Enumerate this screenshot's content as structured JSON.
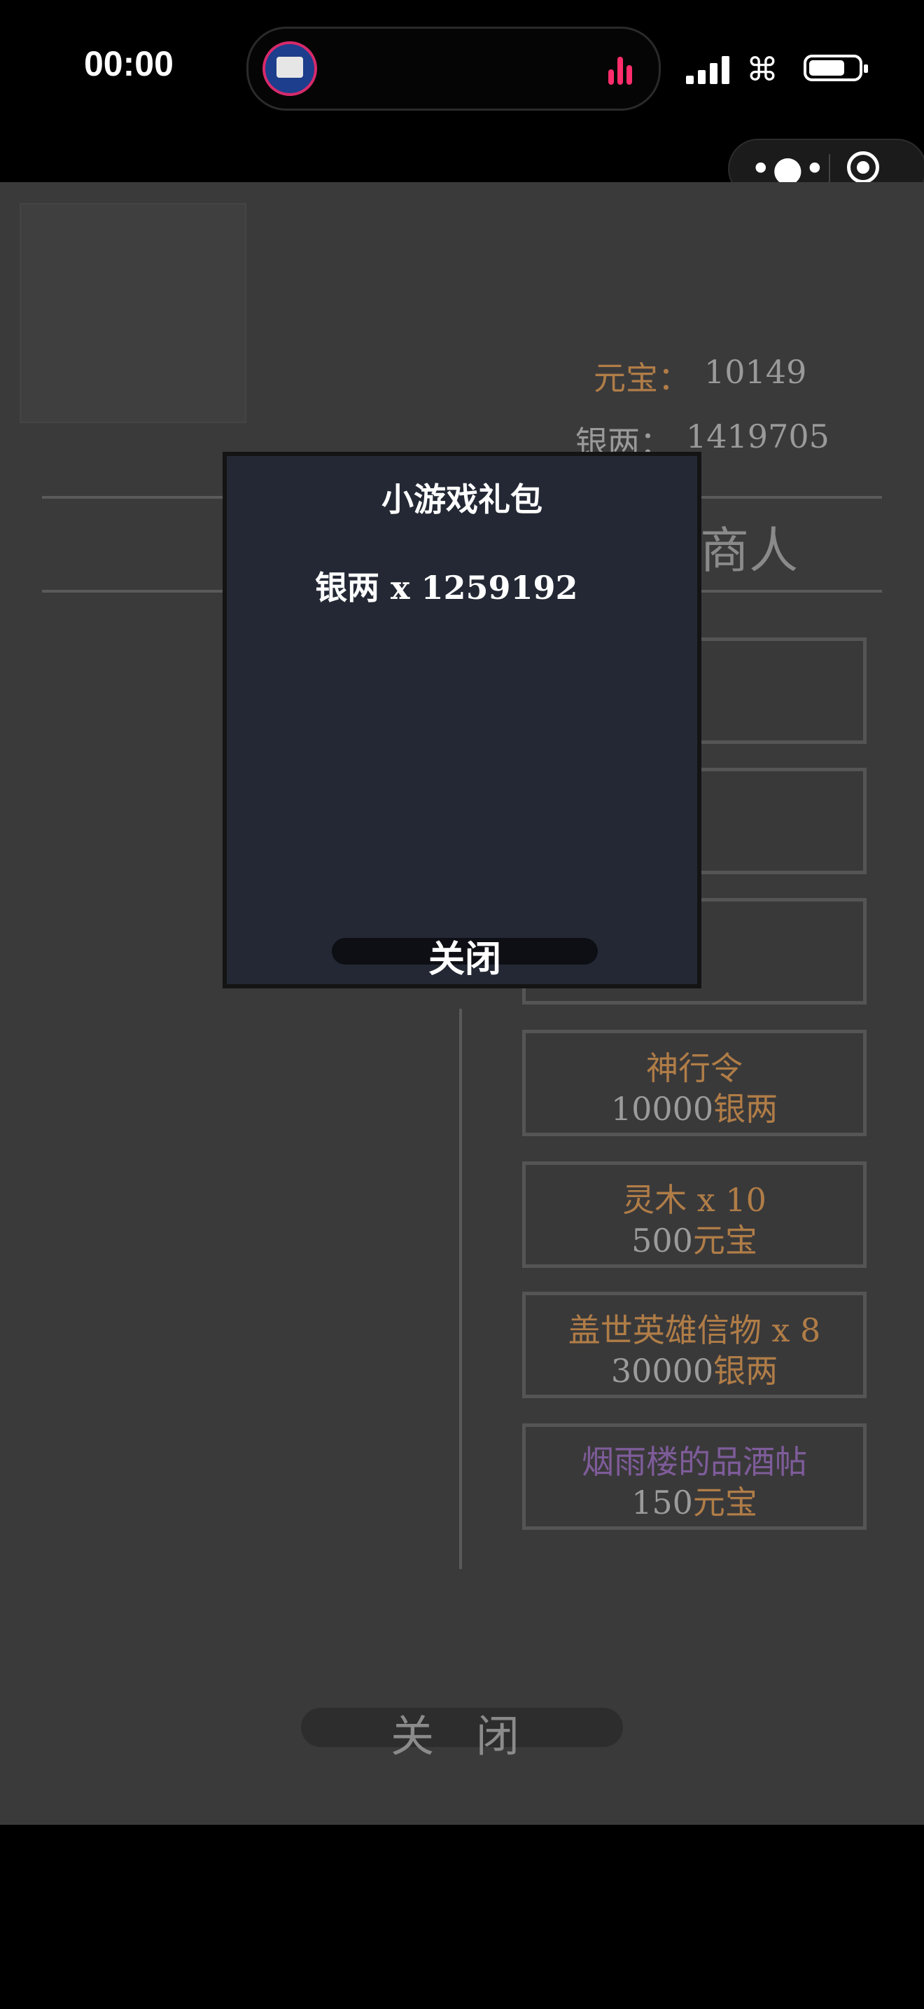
{
  "status_bar": {
    "time": "00:00"
  },
  "mini_program": {
    "more_icon": "ellipsis-icon",
    "close_icon": "target-icon"
  },
  "colors": {
    "game_bg": "#3b3a3b",
    "modal_bg": "#232834",
    "orange": "#b07d47",
    "purple": "#7e5c9a"
  },
  "profile": {
    "yuanbao_label": "元宝：",
    "yuanbao_value": "10149",
    "yinliang_label": "银两：",
    "yinliang_value": "1419705"
  },
  "merchant": {
    "title": "商人",
    "items": [
      {
        "name": "神行令",
        "price_value": "10000",
        "price_unit": "银两",
        "color": "orange"
      },
      {
        "name": "灵木 x 10",
        "price_value": "500",
        "price_unit": "元宝",
        "color": "orange"
      },
      {
        "name": "盖世英雄信物 x 8",
        "price_value": "30000",
        "price_unit": "银两",
        "color": "orange"
      },
      {
        "name": "烟雨楼的品酒帖",
        "price_value": "150",
        "price_unit": "元宝",
        "color": "purple"
      }
    ]
  },
  "bottom_close": "关 闭",
  "modal": {
    "title": "小游戏礼包",
    "reward": "银两 x 1259192",
    "close_label": "关闭"
  }
}
